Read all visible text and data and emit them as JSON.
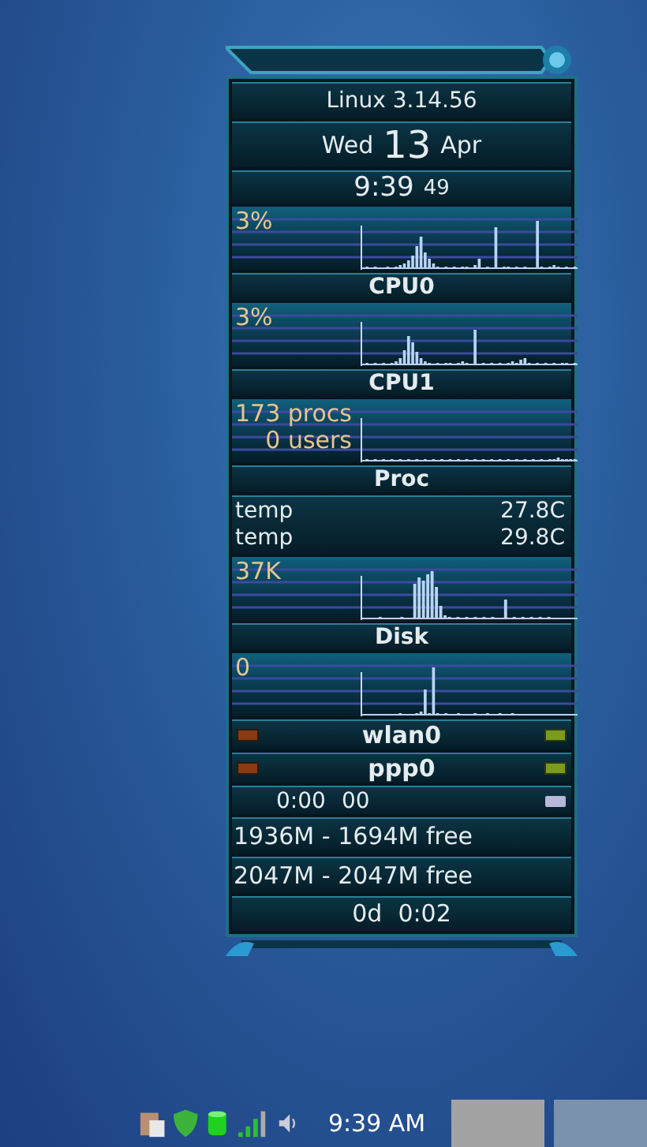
{
  "system": {
    "kernel": "Linux 3.14.56"
  },
  "date": {
    "weekday": "Wed",
    "day": "13",
    "month": "Apr"
  },
  "clock": {
    "time": "9:39",
    "seconds": "49"
  },
  "monitors": [
    {
      "kind": "chart",
      "overlay": [
        "3%"
      ],
      "label": "CPU0"
    },
    {
      "kind": "chart",
      "overlay": [
        "3%"
      ],
      "label": "CPU1"
    },
    {
      "kind": "chart",
      "overlay": [
        "173 procs",
        "0 users"
      ],
      "label": "Proc"
    },
    {
      "kind": "sensors",
      "rows": [
        {
          "name": "temp",
          "value": "27.8C"
        },
        {
          "name": "temp",
          "value": "29.8C"
        }
      ]
    },
    {
      "kind": "chart",
      "overlay": [
        "37K"
      ],
      "label": "Disk"
    },
    {
      "kind": "chart",
      "overlay": [
        "0"
      ]
    },
    {
      "kind": "net",
      "label": "wlan0"
    },
    {
      "kind": "net",
      "label": "ppp0"
    },
    {
      "kind": "timer",
      "time": "0:00",
      "seconds": "00"
    },
    {
      "kind": "text",
      "text": "1936M - 1694M free"
    },
    {
      "kind": "text",
      "text": "2047M - 2047M free"
    },
    {
      "kind": "uptime",
      "days": "0d",
      "time": "0:02"
    }
  ],
  "taskbar": {
    "clock": "9:39 AM"
  }
}
